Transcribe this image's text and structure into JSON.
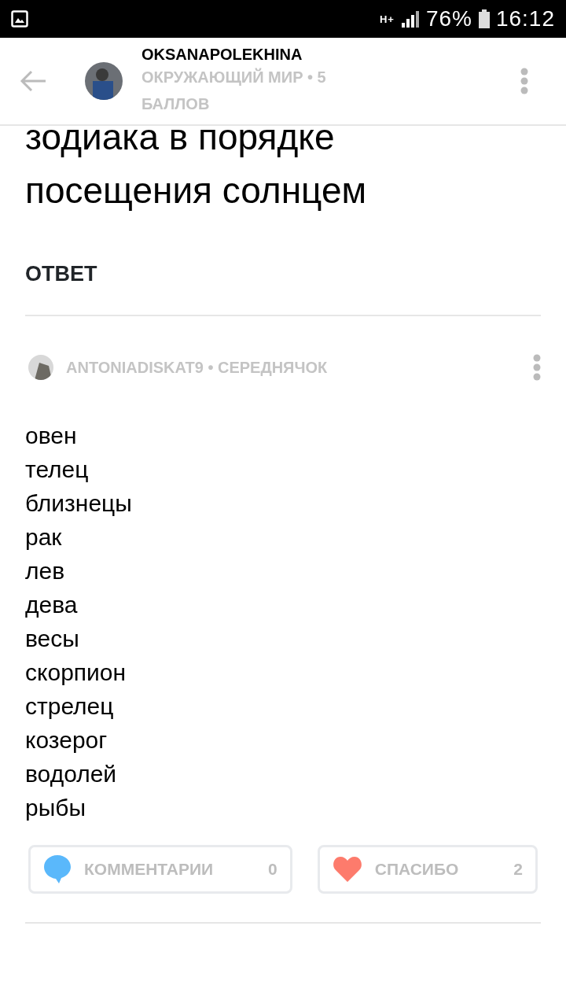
{
  "status_bar": {
    "network": "H+",
    "battery_text": "76%",
    "time": "16:12"
  },
  "header": {
    "username": "OKSANAPOLEKHINA",
    "subject": "ОКРУЖАЮЩИЙ МИР • 5 БАЛЛОВ"
  },
  "question": {
    "lines": [
      "зодиака в порядке",
      "посещения солнцем"
    ]
  },
  "answer_heading": "ОТВЕТ",
  "answer": {
    "author": "ANTONIADISKAT9 • СЕРЕДНЯЧОК",
    "lines": [
      "овен",
      "телец",
      "близнецы",
      "рак",
      "лев",
      "дева",
      "весы",
      "скорпион",
      "стрелец",
      "козерог",
      "водолей",
      "рыбы"
    ],
    "buttons": [
      {
        "kind": "comment",
        "label": "КОММЕНТАРИИ",
        "count": "0"
      },
      {
        "kind": "thanks",
        "label": "СПАСИБО",
        "count": "2"
      }
    ]
  }
}
